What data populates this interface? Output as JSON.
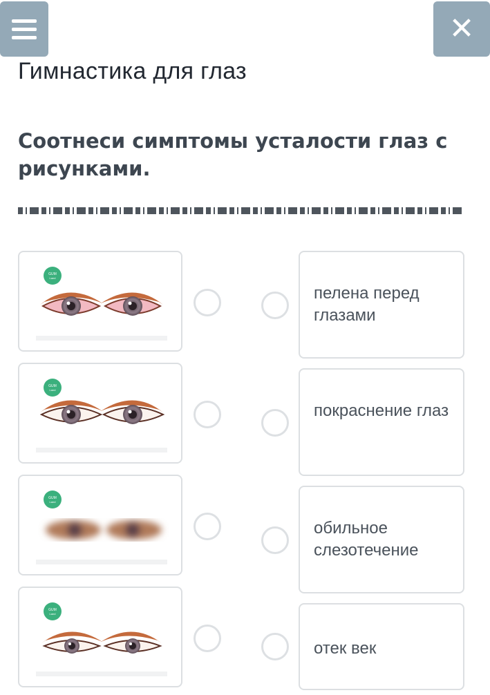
{
  "header": {
    "menu_icon": "hamburger-icon",
    "close_icon": "close-icon"
  },
  "title": "Гимнастика для глаз",
  "question": "Соотнеси симптомы усталости глаз с рисунками.",
  "left_items": [
    {
      "name": "red-eyes-image",
      "logo_text": "GUM Land"
    },
    {
      "name": "normal-eyes-image",
      "logo_text": "GUM Land"
    },
    {
      "name": "blurred-eyes-image",
      "logo_text": "GUM Land"
    },
    {
      "name": "puffy-eyelids-image",
      "logo_text": "GUM Land"
    }
  ],
  "right_items": [
    {
      "label": "пелена перед глазами"
    },
    {
      "label": "покраснение глаз"
    },
    {
      "label": "обильное слезотечение"
    },
    {
      "label": "отек век"
    }
  ],
  "colors": {
    "header_button": "#94a9b7",
    "logo": "#3bb07d",
    "card_border": "#dcdfe2"
  }
}
